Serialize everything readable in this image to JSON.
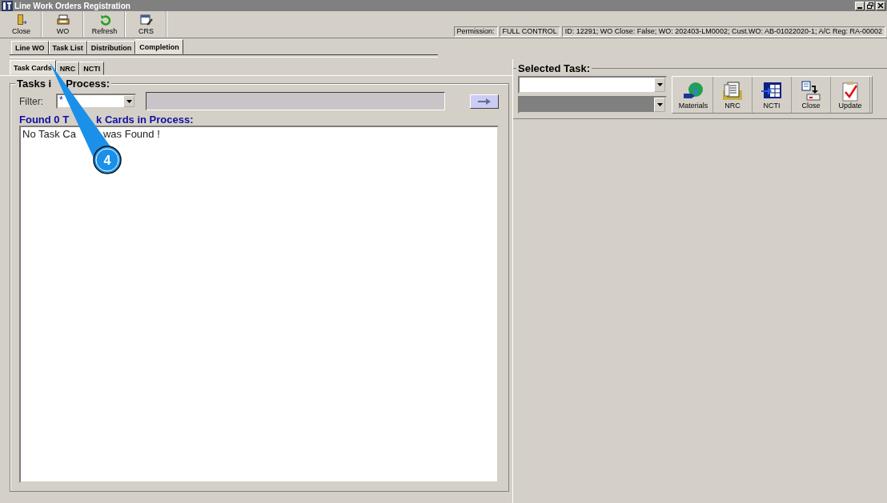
{
  "window": {
    "title": "Line Work Orders Registration"
  },
  "toolbar": [
    {
      "label": "Close",
      "kind": "exit"
    },
    {
      "label": "WO",
      "kind": "wo"
    },
    {
      "label": "Refresh",
      "kind": "refresh"
    },
    {
      "label": "CRS",
      "kind": "crs"
    }
  ],
  "status": {
    "permission_label": "Permission:",
    "permission": "FULL CONTROL",
    "info": "ID: 12291; WO Close: False; WO: 202403-LM0002; Cust.WO: AB-01022020-1; A/C Reg: RA-00002"
  },
  "tabs": [
    {
      "label": "Line WO",
      "selected": false
    },
    {
      "label": "Task List",
      "selected": false
    },
    {
      "label": "Distribution",
      "selected": false
    },
    {
      "label": "Completion",
      "selected": true
    }
  ],
  "subtabs": [
    {
      "label": "Task Cards",
      "selected": true
    },
    {
      "label": "NRC",
      "selected": false
    },
    {
      "label": "NCTI",
      "selected": false
    }
  ],
  "tasks_panel": {
    "title_parts": [
      "Tasks i",
      "Process:"
    ],
    "filter_label": "Filter:",
    "filter_value": "*",
    "found_label_parts": [
      "Found 0 T",
      "k Cards in Process:"
    ],
    "list_message_parts": [
      "No Task Ca",
      "was Found !"
    ]
  },
  "selected_task": {
    "title": "Selected Task:",
    "buttons": [
      {
        "label": "Materials",
        "kind": "materials"
      },
      {
        "label": "NRC",
        "kind": "nrc"
      },
      {
        "label": "NCTI",
        "kind": "ncti"
      },
      {
        "label": "Close",
        "kind": "close"
      },
      {
        "label": "Update",
        "kind": "update"
      }
    ]
  },
  "callout": {
    "number": "4"
  }
}
